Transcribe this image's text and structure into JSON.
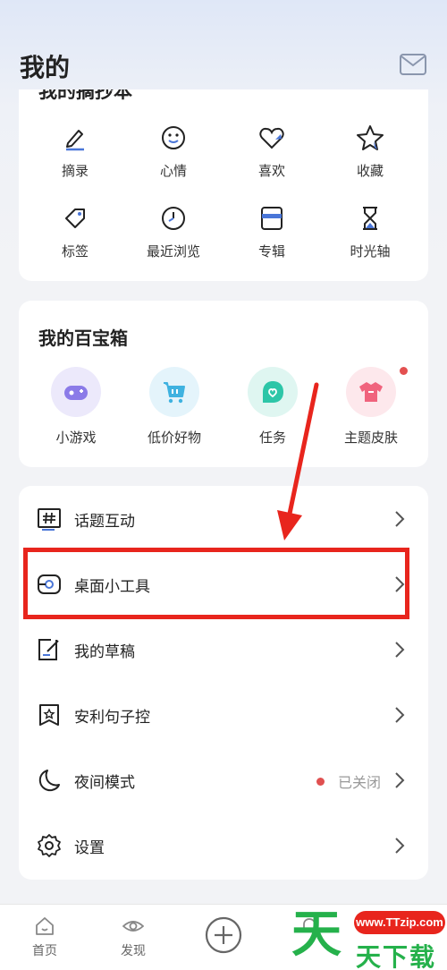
{
  "header": {
    "title": "我的",
    "mail_icon": "mail-icon"
  },
  "notebook": {
    "title": "我的摘抄本",
    "items": [
      {
        "label": "摘录",
        "icon": "pen-icon"
      },
      {
        "label": "心情",
        "icon": "smile-icon"
      },
      {
        "label": "喜欢",
        "icon": "heart-icon"
      },
      {
        "label": "收藏",
        "icon": "star-icon"
      },
      {
        "label": "标签",
        "icon": "tag-icon"
      },
      {
        "label": "最近浏览",
        "icon": "clock-icon"
      },
      {
        "label": "专辑",
        "icon": "album-icon"
      },
      {
        "label": "时光轴",
        "icon": "hourglass-icon"
      }
    ]
  },
  "toolbox": {
    "title": "我的百宝箱",
    "items": [
      {
        "label": "小游戏",
        "icon": "gamepad-icon"
      },
      {
        "label": "低价好物",
        "icon": "cart-icon"
      },
      {
        "label": "任务",
        "icon": "task-icon"
      },
      {
        "label": "主题皮肤",
        "icon": "shirt-icon"
      }
    ]
  },
  "menu": {
    "items": [
      {
        "label": "话题互动",
        "icon": "hashtag-icon"
      },
      {
        "label": "桌面小工具",
        "icon": "widget-icon"
      },
      {
        "label": "我的草稿",
        "icon": "draft-icon"
      },
      {
        "label": "安利句子控",
        "icon": "recommend-icon"
      },
      {
        "label": "夜间模式",
        "icon": "moon-icon",
        "status": "已关闭"
      },
      {
        "label": "设置",
        "icon": "gear-icon"
      }
    ]
  },
  "bottom_nav": {
    "items": [
      {
        "label": "首页",
        "icon": "home-icon"
      },
      {
        "label": "发现",
        "icon": "eye-icon"
      },
      {
        "label": "",
        "icon": "plus-circle-icon"
      },
      {
        "label": "",
        "icon": "notification-icon"
      }
    ]
  },
  "watermark": {
    "url": "www.TTzip.com",
    "big": "天",
    "text": "天下载"
  },
  "colors": {
    "accent_blue": "#4a76d8",
    "highlight_red": "#e8251d",
    "watermark_green": "#25b14b"
  }
}
